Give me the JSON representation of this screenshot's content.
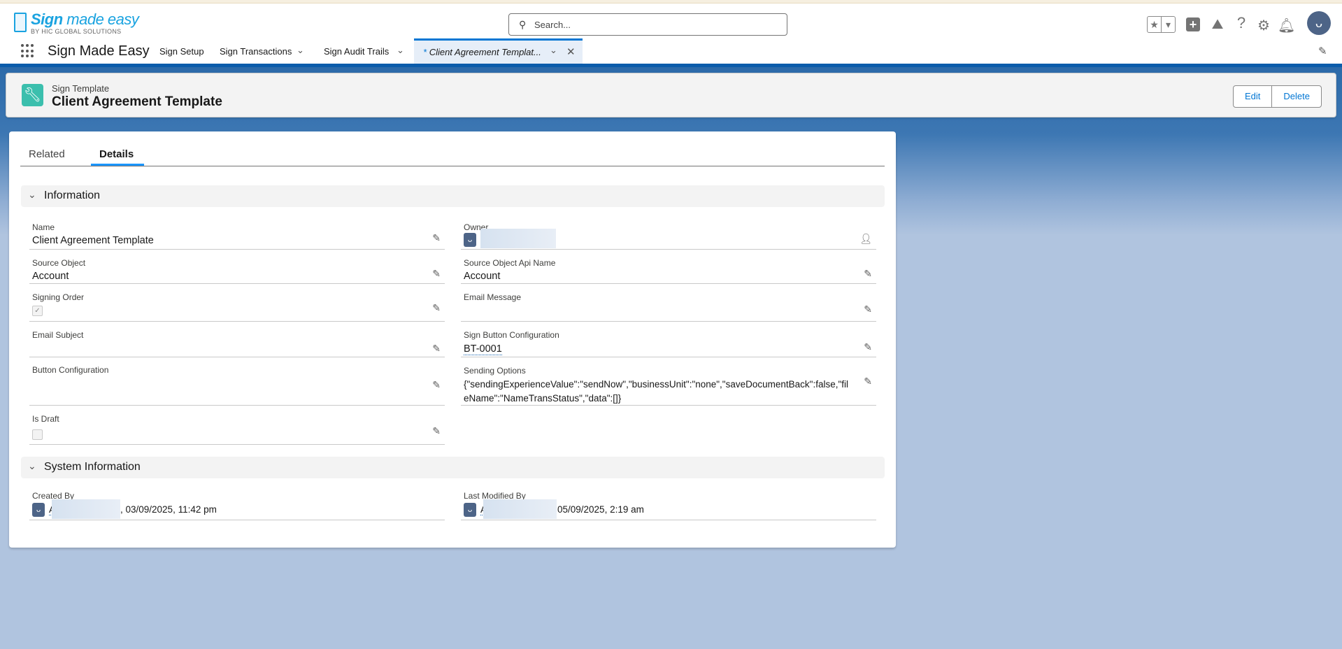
{
  "header": {
    "logo_main_a": "Sign",
    "logo_main_b": " made easy",
    "logo_sub": "BY HIC GLOBAL SOLUTIONS",
    "search_placeholder": "Search..."
  },
  "nav": {
    "app_name": "Sign Made Easy",
    "tabs": [
      {
        "label": "Sign Setup"
      },
      {
        "label": "Sign Transactions"
      },
      {
        "label": "Sign Audit Trails"
      }
    ],
    "active_tab": {
      "modified_marker": "*",
      "label": "Client Agreement Templat..."
    }
  },
  "record": {
    "type": "Sign Template",
    "title": "Client Agreement Template",
    "edit_label": "Edit",
    "delete_label": "Delete"
  },
  "tabs": {
    "related": "Related",
    "details": "Details"
  },
  "sections": {
    "information": "Information",
    "system": "System Information"
  },
  "fields": {
    "name": {
      "label": "Name",
      "value": "Client Agreement Template"
    },
    "source_object": {
      "label": "Source Object",
      "value": "Account"
    },
    "signing_order": {
      "label": "Signing Order",
      "checked": true
    },
    "email_subject": {
      "label": "Email Subject",
      "value": ""
    },
    "button_configuration": {
      "label": "Button Configuration",
      "value": ""
    },
    "is_draft": {
      "label": "Is Draft",
      "checked": false
    },
    "owner": {
      "label": "Owner"
    },
    "source_object_api_name": {
      "label": "Source Object Api Name",
      "value": "Account"
    },
    "email_message": {
      "label": "Email Message",
      "value": ""
    },
    "sign_button_configuration": {
      "label": "Sign Button Configuration",
      "value": "BT-0001"
    },
    "sending_options": {
      "label": "Sending Options",
      "value_line1": "{\"sendingExperienceValue\":\"sendNow\",\"businessUnit\":\"none\",\"saveDocumentBack\":false,\"fil",
      "value_line2": "eName\":\"NameTransStatus\",\"data\":[]}"
    },
    "created_by": {
      "label": "Created By",
      "initial": "A",
      "date": ", 03/09/2025, 11:42 pm"
    },
    "last_modified_by": {
      "label": "Last Modified By",
      "initial": "A",
      "date": "05/09/2025, 2:19 am"
    }
  }
}
